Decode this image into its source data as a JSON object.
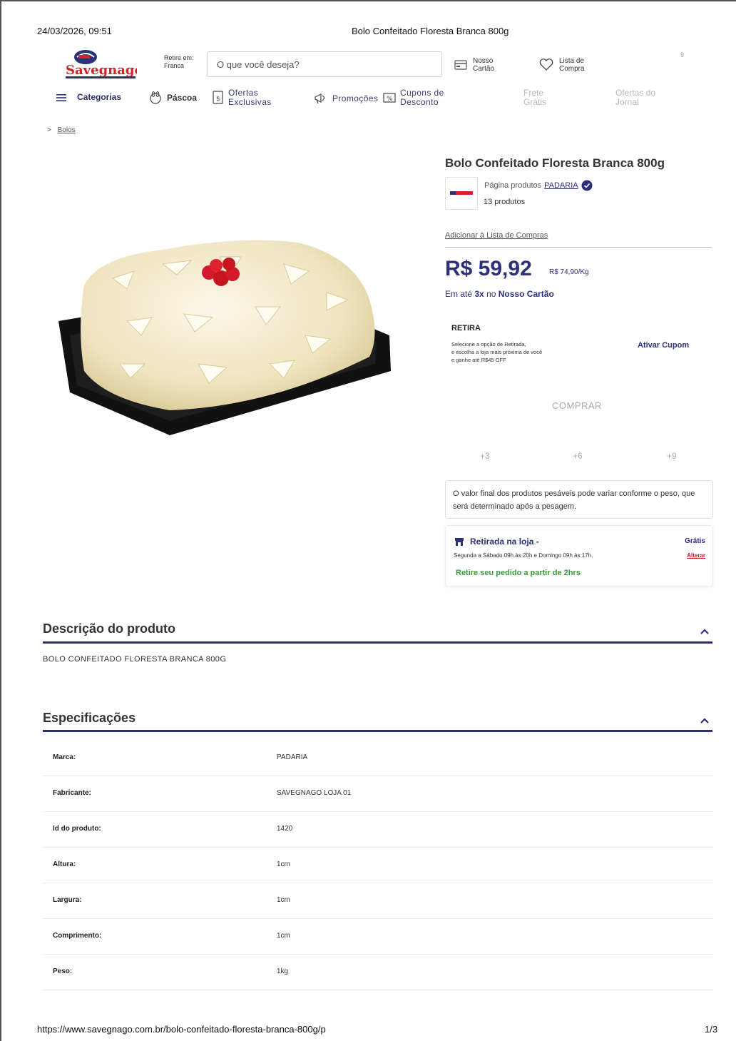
{
  "print": {
    "datetime": "24/03/2026, 09:51",
    "doc_title": "Bolo Confeitado Floresta Branca 800g",
    "url": "https://www.savegnago.com.br/bolo-confeitado-floresta-branca-800g/p",
    "page": "1/3"
  },
  "header": {
    "logo_text": "Savegnago",
    "retire_label": "Retire em:",
    "retire_city": "Franca",
    "search_placeholder": "O que você deseja?",
    "card_line1": "Nosso",
    "card_line2": "Cartão",
    "list_line1": "Lista de",
    "list_line2": "Compra",
    "cart_count": "9"
  },
  "nav": {
    "categorias": "Categorias",
    "pascoa": "Páscoa",
    "ofertas1": "Ofertas",
    "ofertas2": "Exclusivas",
    "promocoes": "Promoções",
    "cupons1": "Cupons de",
    "cupons2": "Desconto",
    "frete1": "Frete",
    "frete2": "Grátis",
    "jornal1": "Ofertas do",
    "jornal2": "Jornal"
  },
  "breadcrumb": {
    "sep": ">",
    "item": "Bolos"
  },
  "product": {
    "title": "Bolo Confeitado Floresta Branca 800g",
    "seller_prefix": "Página produtos",
    "seller_link": "PADARIA",
    "count": "13 produtos",
    "add_list": "Adicionar à Lista de Compras",
    "price": "R$ 59,92",
    "price_kg": "R$ 74,90/Kg",
    "install_pre": "Em até",
    "install_x": "3x",
    "install_mid": "no",
    "install_card": "Nosso Cartão",
    "retira_title": "RETIRA",
    "retira_l1": "Selecione a opção de Retirada,",
    "retira_l2": "e escolha a loja mais próxima de você",
    "retira_l3": "e ganhe até R$45 OFF",
    "cupom": "Ativar Cupom",
    "comprar": "COMPRAR",
    "qty": [
      "+3",
      "+6",
      "+9"
    ],
    "note": "O valor final dos produtos pesáveis pode variar conforme o peso, que será determinado após a pesagem.",
    "pickup_title": "Retirada na loja -",
    "pickup_price": "Grátis",
    "pickup_hours": "Segunda a Sábado 09h às 20h e Domingo 09h às 17h.",
    "pickup_change": "Alterar",
    "pickup_green": "Retire seu pedido a partir de 2hrs"
  },
  "description": {
    "title": "Descrição do produto",
    "text": "BOLO CONFEITADO FLORESTA BRANCA 800G"
  },
  "specs": {
    "title": "Especificações",
    "rows": [
      {
        "k": "Marca:",
        "v": "PADARIA"
      },
      {
        "k": "Fabricante:",
        "v": "SAVEGNAGO LOJA 01"
      },
      {
        "k": "Id do produto:",
        "v": "1420"
      },
      {
        "k": "Altura:",
        "v": "1cm"
      },
      {
        "k": "Largura:",
        "v": "1cm"
      },
      {
        "k": "Comprimento:",
        "v": "1cm"
      },
      {
        "k": "Peso:",
        "v": "1kg"
      }
    ]
  },
  "colors": {
    "brand": "#2c2f7a",
    "logo_red": "#d4202a",
    "green": "#3a9a3a"
  }
}
